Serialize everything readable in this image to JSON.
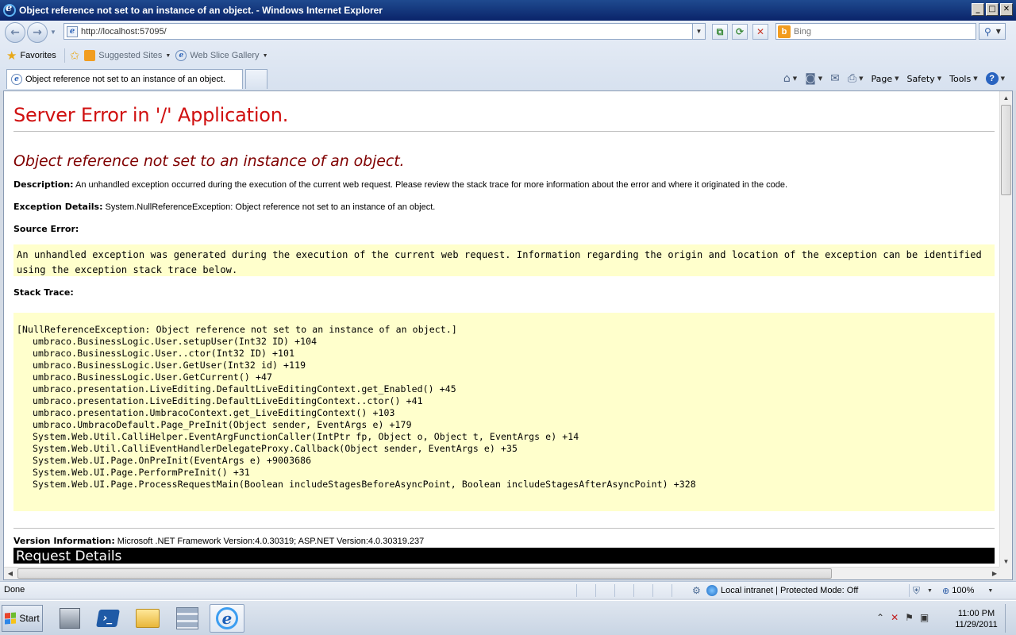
{
  "window": {
    "title": "Object reference not set to an instance of an object. - Windows Internet Explorer",
    "controls": {
      "minimize": "_",
      "maximize": "□",
      "close": "✕"
    }
  },
  "navigation": {
    "back_icon": "back-arrow-icon",
    "forward_icon": "forward-arrow-icon",
    "address": "http://localhost:57095/",
    "search_engine": "Bing",
    "search_placeholder": "Bing"
  },
  "favorites_bar": {
    "favorites_label": "Favorites",
    "items": [
      {
        "label": "Suggested Sites",
        "icon": "suggested-sites-icon"
      },
      {
        "label": "Web Slice Gallery",
        "icon": "ie-icon"
      }
    ]
  },
  "tabs": [
    {
      "label": "Object reference not set to an instance of an object."
    }
  ],
  "command_bar": {
    "page_label": "Page",
    "safety_label": "Safety",
    "tools_label": "Tools",
    "help_symbol": "?"
  },
  "error_page": {
    "heading": "Server Error in '/' Application.",
    "message": "Object reference not set to an instance of an object.",
    "description_label": "Description:",
    "description": "An unhandled exception occurred during the execution of the current web request. Please review the stack trace for more information about the error and where it originated in the code.",
    "exception_label": "Exception Details:",
    "exception": "System.NullReferenceException: Object reference not set to an instance of an object.",
    "source_error_label": "Source Error:",
    "source_error": "An unhandled exception was generated during the execution of the current web request. Information regarding the origin and location of the exception can be identified using the exception stack trace below.",
    "stack_trace_label": "Stack Trace:",
    "stack_trace_header": "[NullReferenceException: Object reference not set to an instance of an object.]",
    "stack_trace": [
      "umbraco.BusinessLogic.User.setupUser(Int32 ID) +104",
      "umbraco.BusinessLogic.User..ctor(Int32 ID) +101",
      "umbraco.BusinessLogic.User.GetUser(Int32 id) +119",
      "umbraco.BusinessLogic.User.GetCurrent() +47",
      "umbraco.presentation.LiveEditing.DefaultLiveEditingContext.get_Enabled() +45",
      "umbraco.presentation.LiveEditing.DefaultLiveEditingContext..ctor() +41",
      "umbraco.presentation.UmbracoContext.get_LiveEditingContext() +103",
      "umbraco.UmbracoDefault.Page_PreInit(Object sender, EventArgs e) +179",
      "System.Web.Util.CalliHelper.EventArgFunctionCaller(IntPtr fp, Object o, Object t, EventArgs e) +14",
      "System.Web.Util.CalliEventHandlerDelegateProxy.Callback(Object sender, EventArgs e) +35",
      "System.Web.UI.Page.OnPreInit(EventArgs e) +9003686",
      "System.Web.UI.Page.PerformPreInit() +31",
      "System.Web.UI.Page.ProcessRequestMain(Boolean includeStagesBeforeAsyncPoint, Boolean includeStagesAfterAsyncPoint) +328"
    ],
    "version_label": "Version Information:",
    "version": "Microsoft .NET Framework Version:4.0.30319; ASP.NET Version:4.0.30319.237",
    "request_details": "Request Details"
  },
  "status_bar": {
    "status": "Done",
    "zone": "Local intranet | Protected Mode: Off",
    "zoom": "100%"
  },
  "taskbar": {
    "start_label": "Start",
    "apps": [
      {
        "name": "server-manager-icon"
      },
      {
        "name": "powershell-icon"
      },
      {
        "name": "windows-explorer-icon"
      },
      {
        "name": "server-stack-icon"
      },
      {
        "name": "internet-explorer-icon",
        "active": true
      }
    ],
    "clock_time": "11:00 PM",
    "clock_date": "11/29/2011"
  },
  "colors": {
    "heading_red": "#d01010",
    "message_maroon": "#800000",
    "code_background": "#ffffcc",
    "titlebar": "#0a246a"
  }
}
